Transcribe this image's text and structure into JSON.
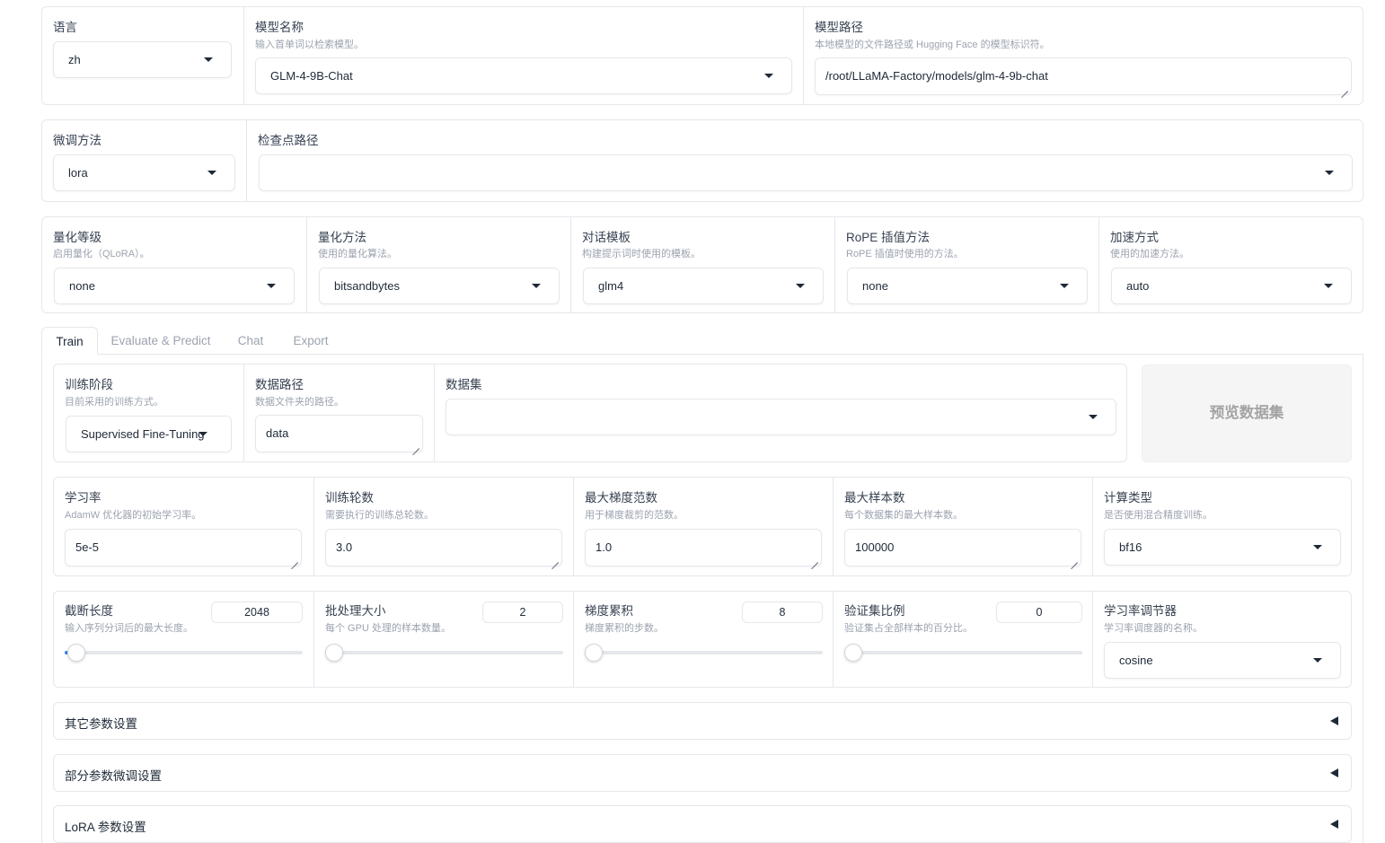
{
  "row1": {
    "lang": {
      "label": "语言",
      "value": "zh"
    },
    "model_name": {
      "label": "模型名称",
      "info": "输入首单词以检索模型。",
      "value": "GLM-4-9B-Chat"
    },
    "model_path": {
      "label": "模型路径",
      "info": "本地模型的文件路径或 Hugging Face 的模型标识符。",
      "value": "/root/LLaMA-Factory/models/glm-4-9b-chat"
    }
  },
  "row2": {
    "finetune": {
      "label": "微调方法",
      "value": "lora"
    },
    "checkpoint": {
      "label": "检查点路径",
      "value": ""
    }
  },
  "row3": {
    "quant_bit": {
      "label": "量化等级",
      "info": "启用量化（QLoRA）。",
      "value": "none"
    },
    "quant_method": {
      "label": "量化方法",
      "info": "使用的量化算法。",
      "value": "bitsandbytes"
    },
    "template": {
      "label": "对话模板",
      "info": "构建提示词时使用的模板。",
      "value": "glm4"
    },
    "rope": {
      "label": "RoPE 插值方法",
      "info": "RoPE 插值时使用的方法。",
      "value": "none"
    },
    "booster": {
      "label": "加速方式",
      "info": "使用的加速方法。",
      "value": "auto"
    }
  },
  "tabs": [
    "Train",
    "Evaluate & Predict",
    "Chat",
    "Export"
  ],
  "train": {
    "stage": {
      "label": "训练阶段",
      "info": "目前采用的训练方式。",
      "value": "Supervised Fine-Tuning"
    },
    "dataset_dir": {
      "label": "数据路径",
      "info": "数据文件夹的路径。",
      "value": "data"
    },
    "dataset": {
      "label": "数据集",
      "value": ""
    },
    "preview_btn": "预览数据集",
    "lr": {
      "label": "学习率",
      "info": "AdamW 优化器的初始学习率。",
      "value": "5e-5"
    },
    "epochs": {
      "label": "训练轮数",
      "info": "需要执行的训练总轮数。",
      "value": "3.0"
    },
    "max_grad_norm": {
      "label": "最大梯度范数",
      "info": "用于梯度裁剪的范数。",
      "value": "1.0"
    },
    "max_samples": {
      "label": "最大样本数",
      "info": "每个数据集的最大样本数。",
      "value": "100000"
    },
    "compute_type": {
      "label": "计算类型",
      "info": "是否使用混合精度训练。",
      "value": "bf16"
    },
    "cutoff_len": {
      "label": "截断长度",
      "info": "输入序列分词后的最大长度。",
      "value": "2048",
      "fraction": 0.0
    },
    "batch_size": {
      "label": "批处理大小",
      "info": "每个 GPU 处理的样本数量。",
      "value": "2",
      "fraction": 0.0
    },
    "grad_accum": {
      "label": "梯度累积",
      "info": "梯度累积的步数。",
      "value": "8",
      "fraction": 0.0
    },
    "val_size": {
      "label": "验证集比例",
      "info": "验证集占全部样本的百分比。",
      "value": "0",
      "fraction": 0.0
    },
    "scheduler": {
      "label": "学习率调节器",
      "info": "学习率调度器的名称。",
      "value": "cosine"
    }
  },
  "accordions": [
    "其它参数设置",
    "部分参数微调设置",
    "LoRA 参数设置"
  ]
}
